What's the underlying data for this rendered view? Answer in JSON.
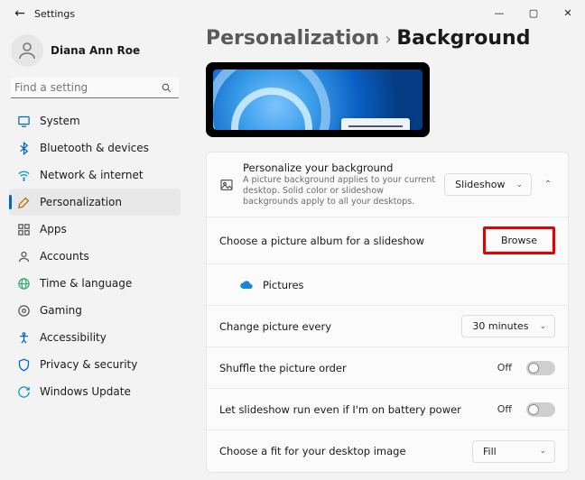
{
  "window": {
    "title": "Settings"
  },
  "user": {
    "name": "Diana Ann Roe",
    "email": " "
  },
  "search": {
    "placeholder": "Find a setting"
  },
  "nav": [
    {
      "label": "System"
    },
    {
      "label": "Bluetooth & devices"
    },
    {
      "label": "Network & internet"
    },
    {
      "label": "Personalization"
    },
    {
      "label": "Apps"
    },
    {
      "label": "Accounts"
    },
    {
      "label": "Time & language"
    },
    {
      "label": "Gaming"
    },
    {
      "label": "Accessibility"
    },
    {
      "label": "Privacy & security"
    },
    {
      "label": "Windows Update"
    }
  ],
  "breadcrumb": {
    "parent": "Personalization",
    "sep": "›",
    "current": "Background"
  },
  "panel": {
    "personalize": {
      "title": "Personalize your background",
      "sub": "A picture background applies to your current desktop. Solid color or slideshow backgrounds apply to all your desktops.",
      "select": "Slideshow"
    },
    "album": {
      "label": "Choose a picture album for a slideshow",
      "button": "Browse",
      "folder": "Pictures"
    },
    "interval": {
      "label": "Change picture every",
      "select": "30 minutes"
    },
    "shuffle": {
      "label": "Shuffle the picture order",
      "state": "Off"
    },
    "battery": {
      "label": "Let slideshow run even if I'm on battery power",
      "state": "Off"
    },
    "fit": {
      "label": "Choose a fit for your desktop image",
      "select": "Fill"
    }
  }
}
